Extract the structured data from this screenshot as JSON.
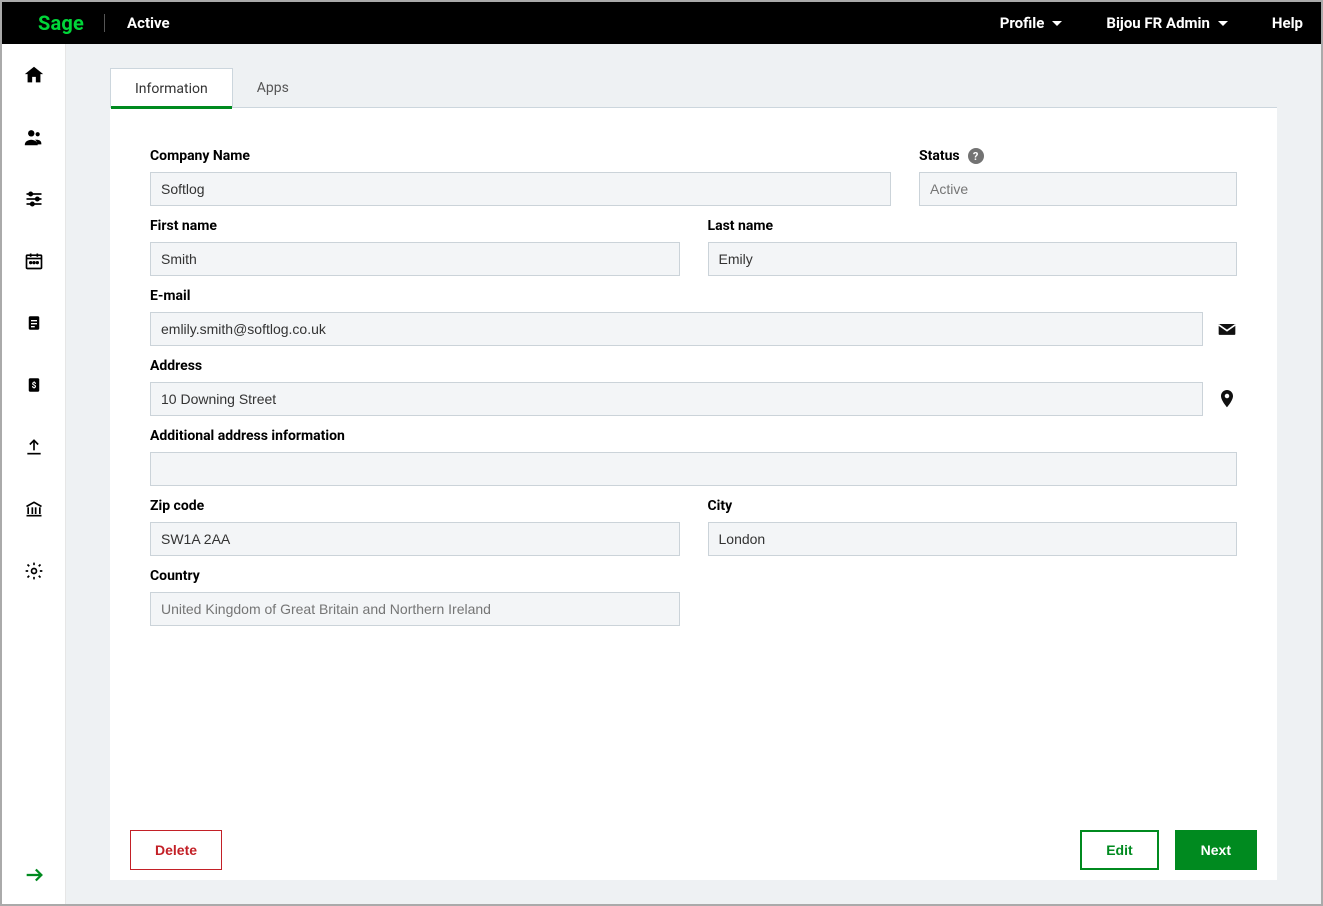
{
  "header": {
    "logo_text": "Sage",
    "active_label": "Active",
    "profile_label": "Profile",
    "user_label": "Bijou FR Admin",
    "help_label": "Help"
  },
  "tabs": {
    "information": "Information",
    "apps": "Apps"
  },
  "form": {
    "company_name_label": "Company Name",
    "company_name_value": "Softlog",
    "status_label": "Status",
    "status_value": "Active",
    "first_name_label": "First name",
    "first_name_value": "Smith",
    "last_name_label": "Last name",
    "last_name_value": "Emily",
    "email_label": "E-mail",
    "email_value": "emlily.smith@softlog.co.uk",
    "address_label": "Address",
    "address_value": "10 Downing Street",
    "addl_address_label": "Additional address information",
    "addl_address_value": "",
    "zip_label": "Zip code",
    "zip_value": "SW1A 2AA",
    "city_label": "City",
    "city_value": "London",
    "country_label": "Country",
    "country_value": "United Kingdom of Great Britain and Northern Ireland"
  },
  "footer": {
    "delete_label": "Delete",
    "edit_label": "Edit",
    "next_label": "Next"
  }
}
